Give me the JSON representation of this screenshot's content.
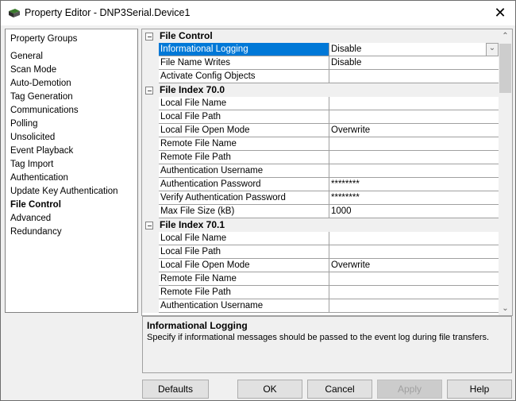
{
  "window": {
    "title": "Property Editor - DNP3Serial.Device1",
    "app_icon": "device-icon",
    "close_icon": "close-icon"
  },
  "groups": {
    "header": "Property Groups",
    "items": [
      {
        "label": "General"
      },
      {
        "label": "Scan Mode"
      },
      {
        "label": "Auto-Demotion"
      },
      {
        "label": "Tag Generation"
      },
      {
        "label": "Communications"
      },
      {
        "label": "Polling"
      },
      {
        "label": "Unsolicited"
      },
      {
        "label": "Event Playback"
      },
      {
        "label": "Tag Import"
      },
      {
        "label": "Authentication"
      },
      {
        "label": "Update Key Authentication"
      },
      {
        "label": "File Control",
        "selected": true
      },
      {
        "label": "Advanced"
      },
      {
        "label": "Redundancy"
      }
    ]
  },
  "grid": {
    "categories": [
      {
        "title": "File Control",
        "rows": [
          {
            "name": "Informational Logging",
            "value": "Disable",
            "selected": true,
            "dropdown": true
          },
          {
            "name": "File Name Writes",
            "value": "Disable"
          },
          {
            "name": "Activate Config Objects",
            "value": ""
          }
        ]
      },
      {
        "title": "File Index 70.0",
        "rows": [
          {
            "name": "Local File Name",
            "value": ""
          },
          {
            "name": "Local File Path",
            "value": ""
          },
          {
            "name": "Local File Open Mode",
            "value": "Overwrite"
          },
          {
            "name": "Remote File Name",
            "value": ""
          },
          {
            "name": "Remote File Path",
            "value": ""
          },
          {
            "name": "Authentication Username",
            "value": ""
          },
          {
            "name": "Authentication Password",
            "value": "********"
          },
          {
            "name": "Verify Authentication Password",
            "value": "********"
          },
          {
            "name": "Max File Size (kB)",
            "value": "1000"
          }
        ]
      },
      {
        "title": "File Index 70.1",
        "rows": [
          {
            "name": "Local File Name",
            "value": ""
          },
          {
            "name": "Local File Path",
            "value": ""
          },
          {
            "name": "Local File Open Mode",
            "value": "Overwrite"
          },
          {
            "name": "Remote File Name",
            "value": ""
          },
          {
            "name": "Remote File Path",
            "value": ""
          },
          {
            "name": "Authentication Username",
            "value": ""
          }
        ]
      }
    ],
    "scroll_up_icon": "chevron-up-icon",
    "scroll_down_icon": "chevron-down-icon"
  },
  "description": {
    "title": "Informational Logging",
    "text": "Specify if informational messages should be passed to the event log during file transfers."
  },
  "buttons": {
    "defaults": "Defaults",
    "ok": "OK",
    "cancel": "Cancel",
    "apply": "Apply",
    "help": "Help"
  }
}
